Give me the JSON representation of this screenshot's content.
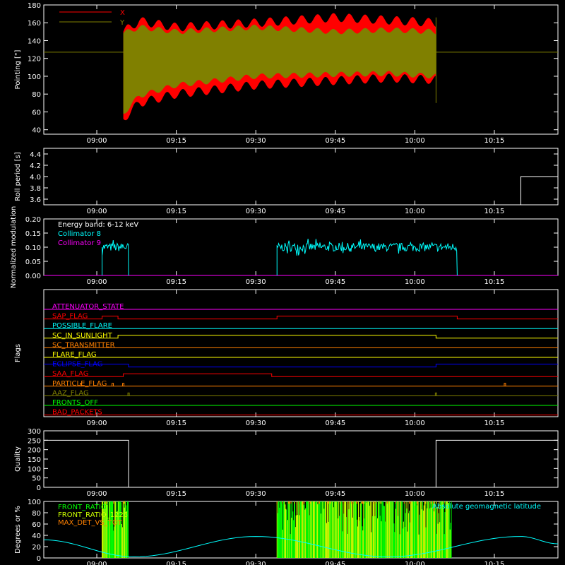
{
  "chart_data": {
    "type": "line",
    "time_axis": {
      "range": [
        "08:50",
        "10:27"
      ],
      "tick_labels": [
        "09:00",
        "09:15",
        "09:30",
        "09:45",
        "10:00",
        "10:15"
      ]
    },
    "panels": [
      {
        "id": "pointing",
        "ylabel": "Pointing [\"]",
        "ylim": [
          35,
          180
        ],
        "yticks": [
          40,
          60,
          80,
          100,
          120,
          140,
          160,
          180
        ],
        "legend": [
          {
            "name": "X",
            "color": "#ff0000"
          },
          {
            "name": "Y",
            "color": "#808000"
          }
        ],
        "baseline_value": 127,
        "series": [
          {
            "name": "X",
            "color": "#ff0000",
            "x": [
              "09:05",
              "09:08",
              "09:15",
              "09:30",
              "09:45",
              "09:55",
              "10:04"
            ],
            "upper": [
              150,
              162,
              155,
              160,
              166,
              163,
              160
            ],
            "lower": [
              52,
              70,
              80,
              90,
              95,
              98,
              96
            ]
          },
          {
            "name": "Y",
            "color": "#808000",
            "x": [
              "09:05",
              "09:08",
              "09:15",
              "09:30",
              "09:45",
              "09:55",
              "10:04"
            ],
            "upper": [
              148,
              155,
              150,
              155,
              150,
              152,
              150
            ],
            "lower": [
              58,
              78,
              90,
              100,
              102,
              103,
              100
            ]
          }
        ]
      },
      {
        "id": "roll",
        "ylabel": "Roll period [s]",
        "ylim": [
          3.5,
          4.5
        ],
        "yticks": [
          3.6,
          3.8,
          4.0,
          4.2,
          4.4
        ],
        "series": [
          {
            "name": "roll period",
            "color": "#ffffff",
            "x": [
              "10:20",
              "10:20",
              "10:27"
            ],
            "y": [
              3.5,
              4.0,
              4.0
            ]
          }
        ]
      },
      {
        "id": "modulation",
        "ylabel": "Normalized modulation",
        "ylim": [
          0,
          0.2
        ],
        "yticks": [
          0.0,
          0.05,
          0.1,
          0.15,
          0.2
        ],
        "annotation": "Energy band: 6-12 keV",
        "legend": [
          {
            "name": "Collimator 8",
            "color": "#00ffff"
          },
          {
            "name": "Collimator 9",
            "color": "#ff00ff"
          }
        ],
        "series": [
          {
            "name": "Collimator 8",
            "color": "#00ffff",
            "segments": [
              {
                "x": [
                  "09:01",
                  "09:06"
                ],
                "mean": 0.1,
                "spread": 0.03
              },
              {
                "x": [
                  "09:34",
                  "10:08"
                ],
                "mean": 0.1,
                "spread": 0.03
              }
            ]
          },
          {
            "name": "Collimator 9",
            "color": "#ff00ff",
            "y": 0.0
          }
        ]
      },
      {
        "id": "flags",
        "ylabel": "Flags",
        "flags": [
          {
            "name": "ATTENUATOR_STATE",
            "color": "#ff00ff",
            "transitions": []
          },
          {
            "name": "SAP_FLAG",
            "color": "#ff0000",
            "transitions": [
              [
                "08:50",
                0
              ],
              [
                "09:01",
                1
              ],
              [
                "09:04",
                0
              ],
              [
                "09:34",
                1
              ],
              [
                "10:08",
                0
              ]
            ]
          },
          {
            "name": "POSSIBLE_FLARE",
            "color": "#00ffff",
            "transitions": []
          },
          {
            "name": "SC_IN_SUNLIGHT",
            "color": "#ffff00",
            "transitions": [
              [
                "08:50",
                0
              ],
              [
                "09:04",
                1
              ],
              [
                "10:04",
                0
              ]
            ]
          },
          {
            "name": "SC_TRANSMITTER",
            "color": "#ff8000",
            "transitions": []
          },
          {
            "name": "FLARE_FLAG",
            "color": "#ffff00",
            "transitions": []
          },
          {
            "name": "ECLIPSE_FLAG",
            "color": "#0000ff",
            "transitions": [
              [
                "08:50",
                1
              ],
              [
                "09:06",
                0
              ],
              [
                "10:04",
                1
              ]
            ]
          },
          {
            "name": "SAA_FLAG",
            "color": "#ff0000",
            "transitions": [
              [
                "08:50",
                0
              ],
              [
                "09:05",
                1
              ],
              [
                "09:33",
                0
              ]
            ]
          },
          {
            "name": "PARTICLE_FLAG",
            "color": "#ff8000",
            "spikes": [
              "08:57",
              "09:03",
              "09:05",
              "10:17"
            ]
          },
          {
            "name": "AAZ_FLAG",
            "color": "#808000",
            "spikes": [
              "09:06",
              "10:04"
            ]
          },
          {
            "name": "FRONTS_OFF",
            "color": "#00ff00",
            "transitions": []
          },
          {
            "name": "BAD_PACKETS",
            "color": "#ff0000",
            "transitions": []
          }
        ]
      },
      {
        "id": "quality",
        "ylabel": "Quality",
        "ylim": [
          0,
          300
        ],
        "yticks": [
          0,
          50,
          100,
          150,
          200,
          250,
          300
        ],
        "series": [
          {
            "name": "quality",
            "color": "#ffffff",
            "x": [
              "08:50",
              "09:06",
              "09:06",
              "10:04",
              "10:04",
              "10:27"
            ],
            "y": [
              250,
              250,
              0,
              0,
              250,
              250
            ]
          }
        ]
      },
      {
        "id": "ratios",
        "ylabel": "Degrees or %",
        "ylim": [
          0,
          100
        ],
        "yticks": [
          0,
          20,
          40,
          60,
          80,
          100
        ],
        "legend": [
          {
            "name": "FRONT_RATIO",
            "color": "#00ff00"
          },
          {
            "name": "FRONT_RATIO_1225",
            "color": "#ccff00"
          },
          {
            "name": "MAX_DET_VS_TOT",
            "color": "#ff8000"
          }
        ],
        "right_label": "Absolute geomagnetic latitude",
        "latitude": {
          "color": "#00ffff",
          "x": [
            "08:50",
            "09:07",
            "09:30",
            "09:55",
            "10:20",
            "10:27"
          ],
          "y": [
            32,
            2,
            38,
            2,
            38,
            25
          ]
        },
        "bursts": [
          {
            "x": [
              "09:01",
              "09:06"
            ]
          },
          {
            "x": [
              "09:34",
              "10:07"
            ]
          }
        ]
      }
    ]
  }
}
